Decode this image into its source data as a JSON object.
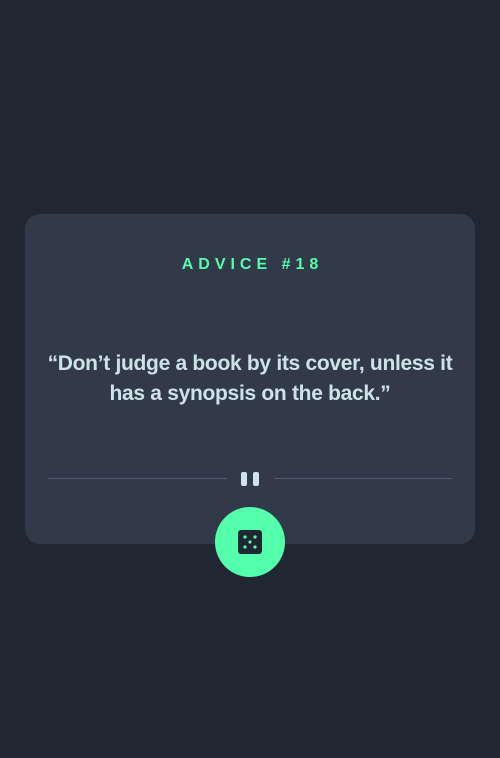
{
  "advice": {
    "id_label": "ADVICE #18",
    "quote": "“Don’t judge a book by its cover, unless it has a synopsis on the back.”"
  },
  "divider": {
    "icon": "pause-icon"
  },
  "dice_button": {
    "icon": "dice-icon"
  },
  "colors": {
    "background": "#202632",
    "card": "#323a49",
    "accent": "#53ffaa",
    "text": "#cee3e9",
    "divider": "#4f5d74"
  }
}
